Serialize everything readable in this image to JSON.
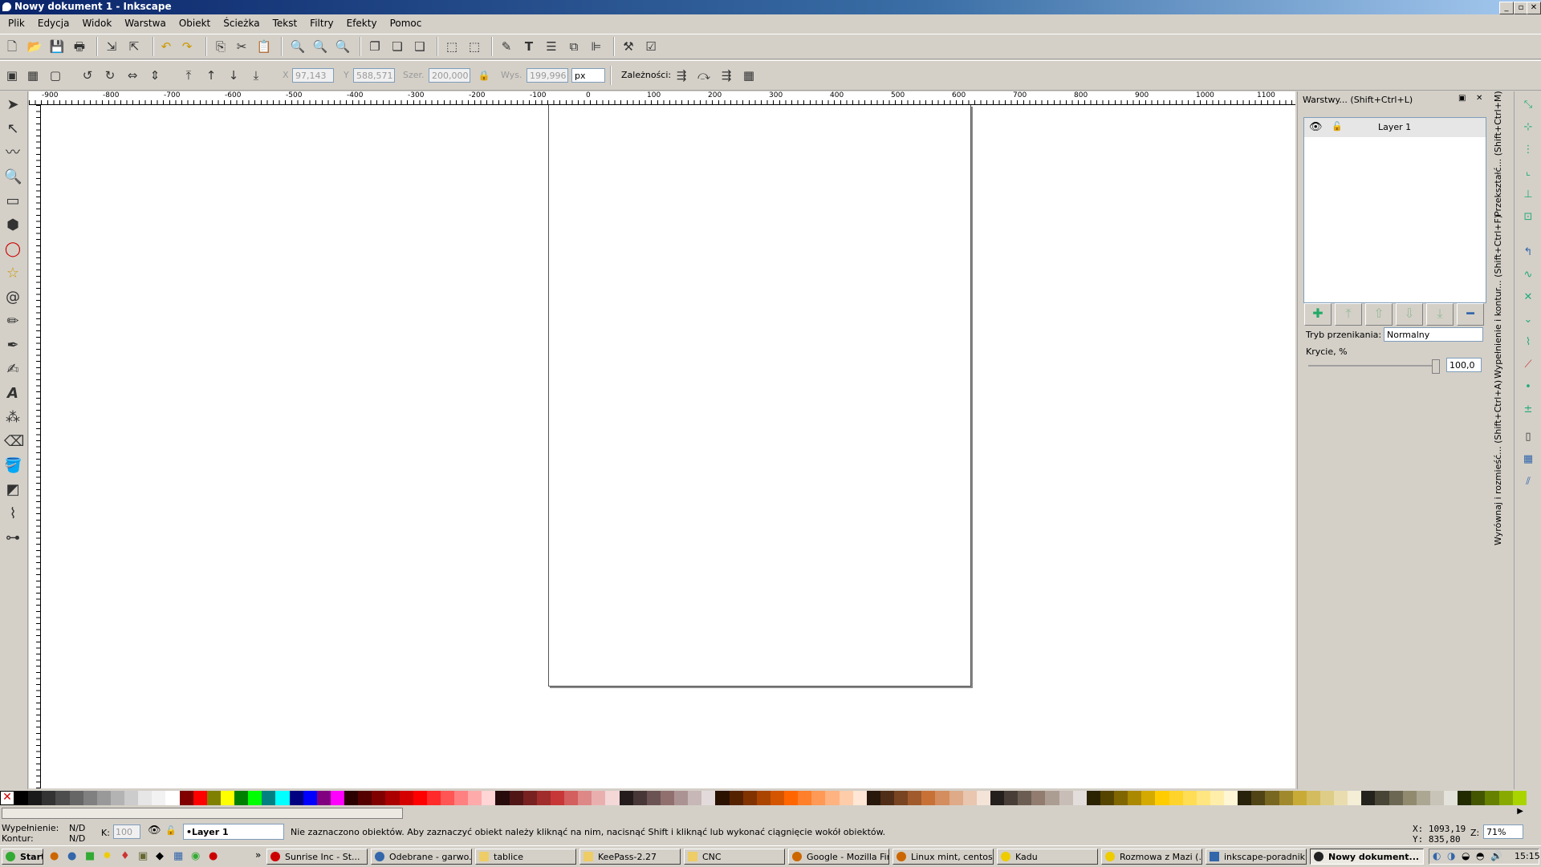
{
  "window": {
    "title": "Nowy dokument 1 - Inkscape"
  },
  "menu": [
    "Plik",
    "Edycja",
    "Widok",
    "Warstwa",
    "Obiekt",
    "Ścieżka",
    "Tekst",
    "Filtry",
    "Efekty",
    "Pomoc"
  ],
  "controls": {
    "x_label": "X",
    "x_value": "97,143",
    "y_label": "Y",
    "y_value": "588,571",
    "w_label": "Szer.",
    "w_value": "200,000",
    "h_label": "Wys.",
    "h_value": "199,996",
    "unit": "px",
    "deps_label": "Zależności:"
  },
  "ruler": {
    "h_ticks": [
      "-900",
      "-800",
      "-700",
      "-600",
      "-500",
      "-400",
      "-300",
      "-200",
      "-100",
      "0",
      "100",
      "200",
      "300",
      "400",
      "500",
      "600",
      "700",
      "800",
      "900",
      "1000",
      "1100"
    ]
  },
  "panel": {
    "title": "Warstwy... (Shift+Ctrl+L)",
    "layer_name": "Layer 1",
    "blend_label": "Tryb przenikania:",
    "blend_value": "Normalny",
    "opacity_label": "Krycie, %",
    "opacity_value": "100,0"
  },
  "side_tabs": [
    "Przekształć... (Shift+Ctrl+M)",
    "Wypełnienie i kontur... (Shift+Ctrl+F)",
    "Wyrównaj i rozmieść... (Shift+Ctrl+A)"
  ],
  "palette": [
    "#000000",
    "#1a1a1a",
    "#333333",
    "#4d4d4d",
    "#666666",
    "#808080",
    "#999999",
    "#b3b3b3",
    "#cccccc",
    "#e6e6e6",
    "#f2f2f2",
    "#ffffff",
    "#800000",
    "#ff0000",
    "#808000",
    "#ffff00",
    "#008000",
    "#00ff00",
    "#008080",
    "#00ffff",
    "#000080",
    "#0000ff",
    "#800080",
    "#ff00ff",
    "#2b0000",
    "#550000",
    "#800000",
    "#aa0000",
    "#d40000",
    "#ff0000",
    "#ff2a2a",
    "#ff5555",
    "#ff8080",
    "#ffaaaa",
    "#ffd5d5",
    "#280b0b",
    "#501616",
    "#782121",
    "#a02c2c",
    "#c83737",
    "#d35f5f",
    "#de8787",
    "#e9afaf",
    "#f4d7d7",
    "#241c1c",
    "#483737",
    "#6c5353",
    "#916f6f",
    "#ac9393",
    "#c8b7b7",
    "#e3dbdb",
    "#2b1100",
    "#552200",
    "#803300",
    "#aa4400",
    "#d45500",
    "#ff6600",
    "#ff7f2a",
    "#ff9955",
    "#ffb380",
    "#ffccaa",
    "#ffe6d5",
    "#28170b",
    "#502d16",
    "#784421",
    "#a05a2c",
    "#c87137",
    "#d38d5f",
    "#deaa87",
    "#e9c6af",
    "#f4e3d7",
    "#241f1c",
    "#483e37",
    "#6c5d53",
    "#917c6f",
    "#ac9d93",
    "#c8beb7",
    "#e3dedb",
    "#2b2200",
    "#554400",
    "#806600",
    "#aa8800",
    "#d4aa00",
    "#ffcc00",
    "#ffd42a",
    "#ffdd55",
    "#ffe680",
    "#ffeeaa",
    "#fff6d5",
    "#28220b",
    "#504416",
    "#786721",
    "#a0892c",
    "#c8ab37",
    "#d3bc5f",
    "#decd87",
    "#e9ddaf",
    "#f4eed7",
    "#24221c",
    "#484537",
    "#6c6753",
    "#918a6f",
    "#aca793",
    "#c8c4b7",
    "#e3e2db",
    "#222b00",
    "#445500",
    "#668000",
    "#88aa00",
    "#aad400"
  ],
  "status": {
    "fill_label": "Wypełnienie:",
    "fill_value": "N/D",
    "stroke_label": "Kontur:",
    "stroke_value": "N/D",
    "k_label": "K:",
    "k_value": "100",
    "layer": "•Layer 1",
    "message": "Nie zaznaczono obiektów. Aby zaznaczyć obiekt należy kliknąć na nim, nacisnąć Shift i kliknąć lub wykonać ciągnięcie wokół obiektów.",
    "cursor_x": "X: 1093,19",
    "cursor_y": "Y: 835,80",
    "zoom_label": "Z:",
    "zoom": "71%"
  },
  "taskbar": {
    "start": "Start",
    "tasks": [
      "Sunrise Inc - St...",
      "Odebrane - garwo...",
      "tablice",
      "KeePass-2.27",
      "CNC",
      "Google - Mozilla Fir...",
      "Linux mint, centos...",
      "Kadu",
      "Rozmowa z Mazi (...",
      "inkscape-poradnik...",
      "Nowy dokument..."
    ],
    "clock": "15:15"
  }
}
